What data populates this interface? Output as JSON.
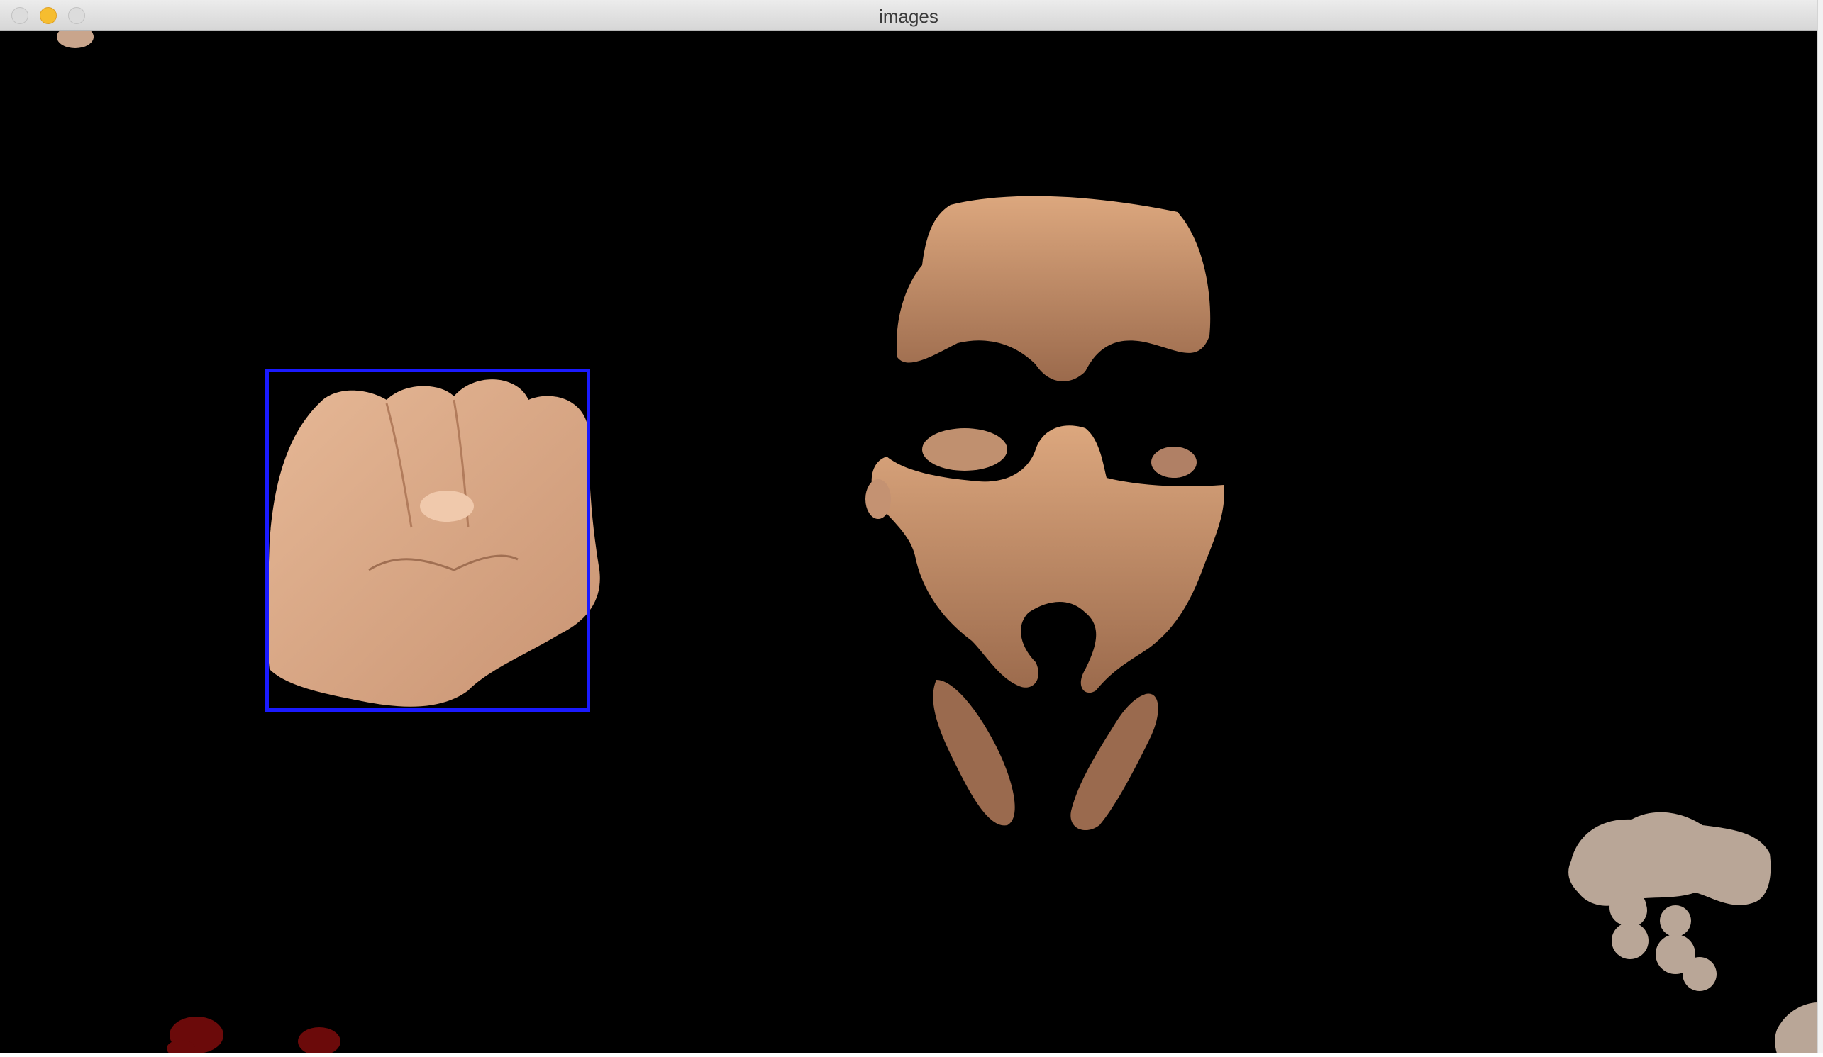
{
  "window": {
    "title": "images"
  },
  "colors": {
    "background": "#000000",
    "detection_box": "#1a1aff",
    "skin": "#d7a078",
    "blob": "#b9a697",
    "red_blob": "#6b0a0a"
  }
}
